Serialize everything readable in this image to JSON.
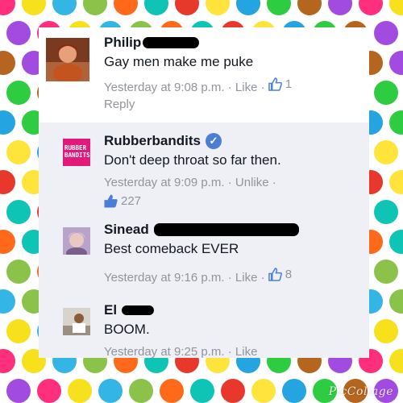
{
  "colors": {
    "dots": [
      "#ff2f7e",
      "#ffe53b",
      "#33b5e5",
      "#2ecc40",
      "#ff6a1a",
      "#a24be0",
      "#e8382c",
      "#f7e11c",
      "#24a4e0",
      "#8bc34a",
      "#b5651d",
      "#0ec4b5"
    ],
    "name": "#141823",
    "meta": "#90949c",
    "like_blue": "#4a7fd5",
    "comment_bg": "#eef0f5"
  },
  "comments": [
    {
      "name": "Philip",
      "text": "Gay men make me puke",
      "time": "Yesterday at 9:08 p.m.",
      "action": "Like",
      "like_count": "1",
      "reply": "Reply",
      "avatar_icon": "profile-photo"
    },
    {
      "name": "Rubberbandits",
      "verified_icon": "verified-badge-icon",
      "text": "Don't deep throat so far then.",
      "time": "Yesterday at 9:09 p.m.",
      "action": "Unlike",
      "like_count": "227",
      "avatar_text": "RUBBER BANDITS"
    },
    {
      "name": "Sinead",
      "text": "Best comeback EVER",
      "time": "Yesterday at 9:16 p.m.",
      "action": "Like",
      "like_count": "8",
      "avatar_icon": "profile-photo"
    },
    {
      "name": "El",
      "text": "BOOM.",
      "time": "Yesterday at 9:25 p.m.",
      "action": "Like",
      "avatar_icon": "profile-photo"
    }
  ],
  "watermark": "PicCollage"
}
